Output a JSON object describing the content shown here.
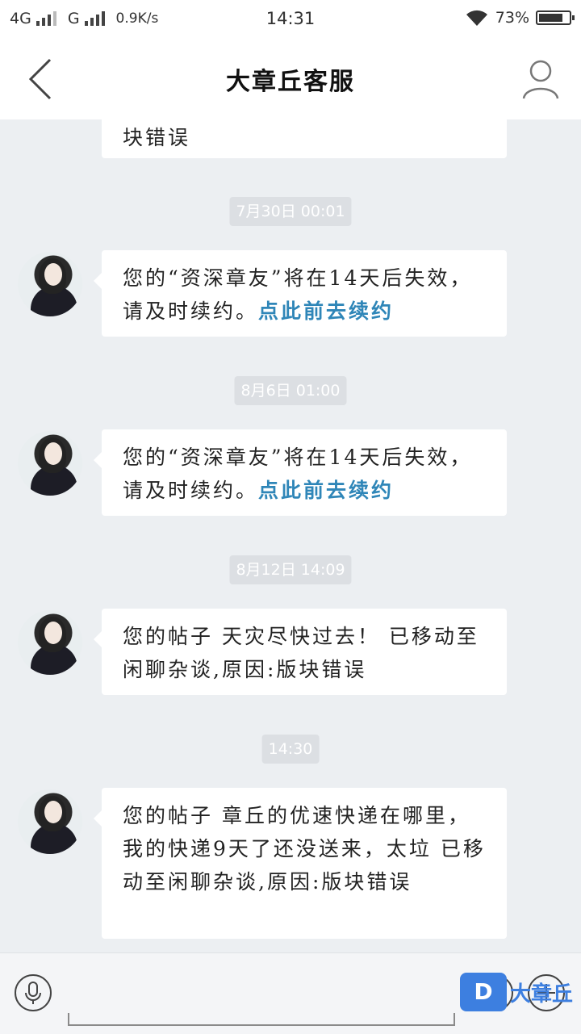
{
  "status_bar": {
    "network1": "4G",
    "network2": "G",
    "speed": "0.9K/s",
    "time": "14:31",
    "battery": "73%",
    "battery_level": 0.73
  },
  "header": {
    "title": "大章丘客服"
  },
  "messages": [
    {
      "text": "块错误"
    },
    {
      "timestamp": "7月30日 00:01",
      "text": "您的“资深章友”将在14天后失效，请及时续约。",
      "link": "点此前去续约"
    },
    {
      "timestamp": "8月6日 01:00",
      "text": "您的“资深章友”将在14天后失效，请及时续约。",
      "link": "点此前去续约"
    },
    {
      "timestamp": "8月12日 14:09",
      "text": "您的帖子 天灾尽快过去！ 已移动至闲聊杂谈,原因:版块错误"
    },
    {
      "timestamp": "14:30",
      "text": "您的帖子 章丘的优速快递在哪里，我的快递9天了还没送来，太垃 已移动至闲聊杂谈,原因:版块错误"
    }
  ],
  "watermark": {
    "logo": "D",
    "text": "大章丘"
  }
}
